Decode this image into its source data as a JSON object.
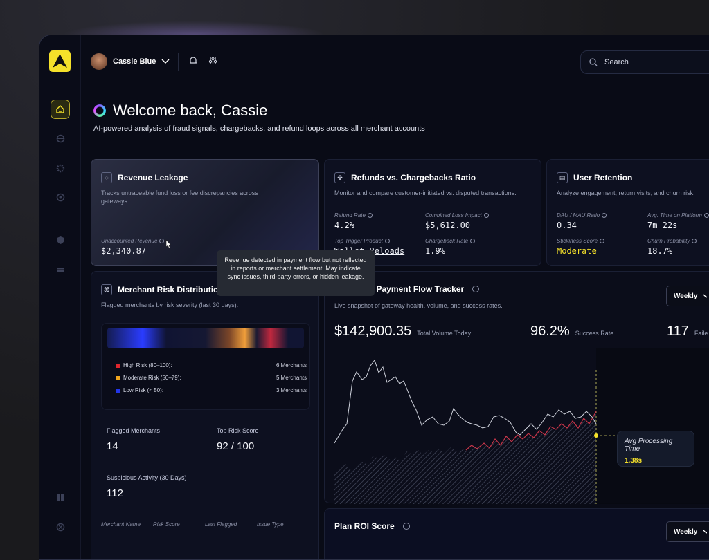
{
  "header": {
    "user_name": "Cassie Blue",
    "search_placeholder": "Search"
  },
  "welcome": {
    "title": "Welcome back, Cassie",
    "subtitle": "AI-powered analysis of fraud signals, chargebacks, and refund loops across all merchant accounts"
  },
  "revenue_leakage": {
    "title": "Revenue Leakage",
    "desc": "Tracks untraceable fund loss or fee discrepancies across gateways.",
    "metric_label": "Unaccounted Revenue",
    "metric_value": "$2,340.87",
    "tooltip": "Revenue detected in payment flow but not reflected in reports or merchant settlement. May indicate sync issues, third-party errors, or hidden leakage."
  },
  "refunds": {
    "title": "Refunds vs. Chargebacks Ratio",
    "desc": "Monitor and compare customer-initiated vs. disputed transactions.",
    "refund_rate_label": "Refund Rate",
    "refund_rate": "4.2%",
    "combined_loss_label": "Combined Loss Impact",
    "combined_loss": "$5,612.00",
    "top_trigger_label": "Top Trigger Product",
    "top_trigger": "Wallet Reloads",
    "chargeback_rate_label": "Chargeback Rate",
    "chargeback_rate": "1.9%"
  },
  "retention": {
    "title": "User Retention",
    "desc": "Analyze engagement, return visits, and churn risk.",
    "dau_label": "DAU / MAU Ratio",
    "dau": "0.34",
    "avg_time_label": "Avg. Time on Platform",
    "avg_time": "7m 22s",
    "stickiness_label": "Stickiness Score",
    "stickiness": "Moderate",
    "churn_label": "Churn Probability",
    "churn": "18.7%"
  },
  "merchant_risk": {
    "title": "Merchant Risk Distribution",
    "desc": "Flagged merchants by risk severity (last 30 days).",
    "levels": [
      {
        "label": "High Risk (80–100):",
        "value": "6 Merchants",
        "color": "#e0262d"
      },
      {
        "label": "Moderate Risk (50–79):",
        "value": "5 Merchants",
        "color": "#f0a51e"
      },
      {
        "label": "Low Risk (< 50):",
        "value": "3 Merchants",
        "color": "#2336e8"
      }
    ],
    "flagged_label": "Flagged Merchants",
    "flagged": "14",
    "top_score_label": "Top Risk Score",
    "top_score": "92 / 100",
    "suspicious_label": "Suspicious Activity (30 Days)",
    "suspicious": "112",
    "columns": [
      "Merchant Name",
      "Risk Score",
      "Last Flagged",
      "Issue Type"
    ]
  },
  "tracker": {
    "title": "Real-Time Payment Flow Tracker",
    "desc": "Live snapshot of gateway health, volume, and success rates.",
    "period": "Weekly",
    "total_volume": "$142,900.35",
    "total_volume_label": "Total Volume Today",
    "success_rate": "96.2%",
    "success_rate_label": "Success Rate",
    "failed": "117",
    "failed_label": "Faile",
    "hover_label": "Avg Processing Time",
    "hover_value": "1.38s"
  },
  "roi": {
    "title": "Plan ROI Score",
    "period": "Weekly"
  },
  "colors": {
    "accent": "#f5e12a",
    "bg": "#090b16",
    "card": "#0d1020"
  }
}
